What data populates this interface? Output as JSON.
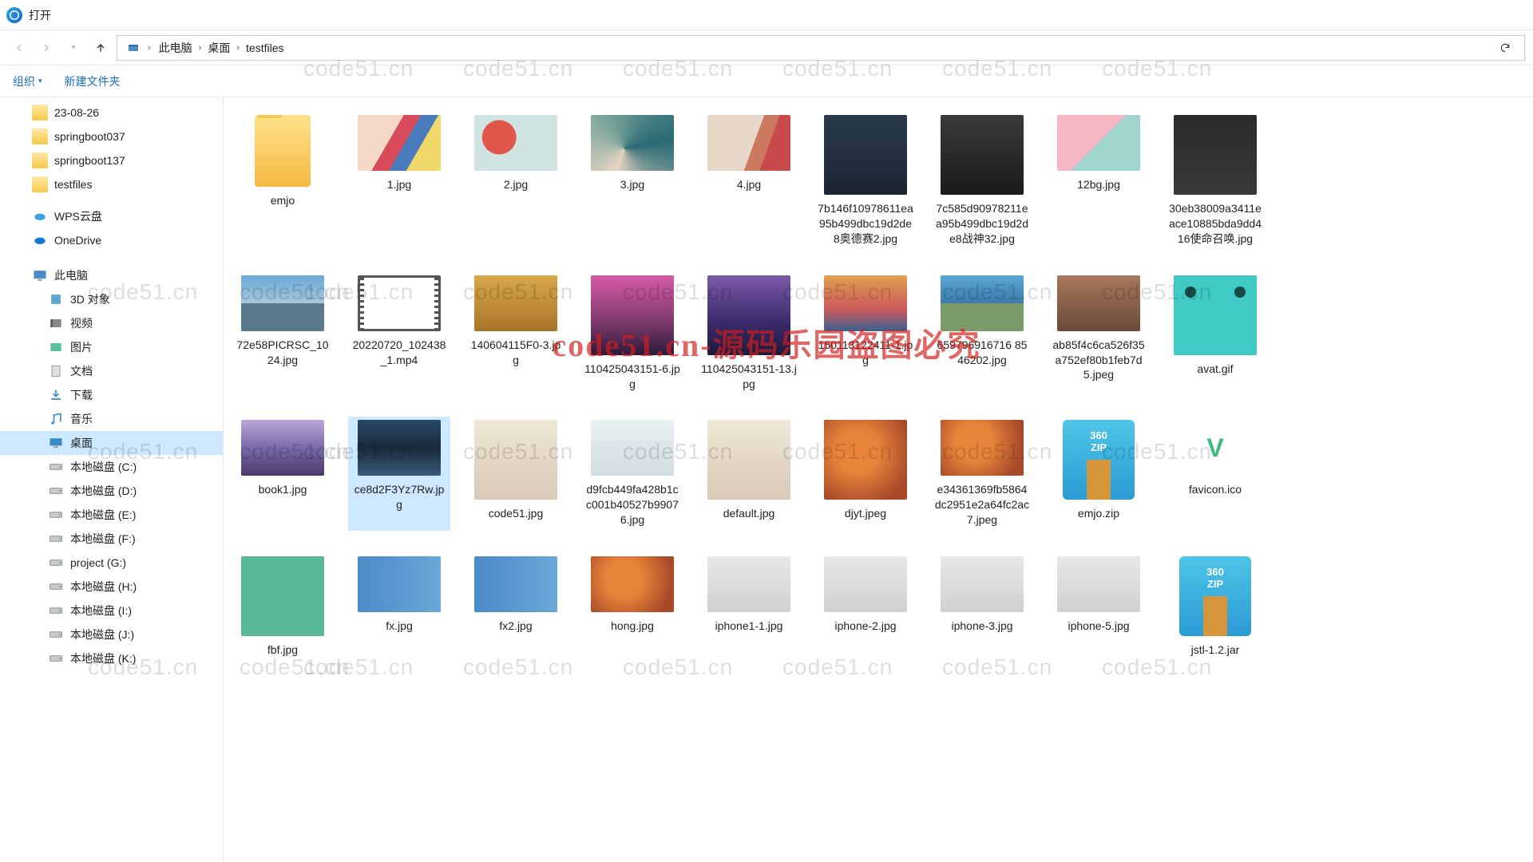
{
  "window": {
    "title": "打开"
  },
  "breadcrumbs": [
    "此电脑",
    "桌面",
    "testfiles"
  ],
  "toolbar": {
    "organize": "组织",
    "new_folder": "新建文件夹"
  },
  "sidebar": {
    "recent_folders": [
      "23-08-26",
      "springboot037",
      "springboot137",
      "testfiles"
    ],
    "clouds": [
      {
        "label": "WPS云盘",
        "icon": "wps"
      },
      {
        "label": "OneDrive",
        "icon": "onedrive"
      }
    ],
    "this_pc": "此电脑",
    "user_folders": [
      {
        "label": "3D 对象",
        "icon": "3d"
      },
      {
        "label": "视频",
        "icon": "video"
      },
      {
        "label": "图片",
        "icon": "pictures"
      },
      {
        "label": "文档",
        "icon": "docs"
      },
      {
        "label": "下载",
        "icon": "downloads"
      },
      {
        "label": "音乐",
        "icon": "music"
      },
      {
        "label": "桌面",
        "icon": "desktop",
        "selected": true
      }
    ],
    "drives": [
      "本地磁盘 (C:)",
      "本地磁盘 (D:)",
      "本地磁盘 (E:)",
      "本地磁盘 (F:)",
      "project (G:)",
      "本地磁盘 (H:)",
      "本地磁盘 (I:)",
      "本地磁盘 (J:)",
      "本地磁盘 (K:)"
    ]
  },
  "files": [
    {
      "name": "emjo",
      "type": "folder"
    },
    {
      "name": "1.jpg",
      "thumb": "art1"
    },
    {
      "name": "2.jpg",
      "thumb": "art2"
    },
    {
      "name": "3.jpg",
      "thumb": "art3"
    },
    {
      "name": "4.jpg",
      "thumb": "art4"
    },
    {
      "name": "7b146f10978611ea95b499dbc19d2de8奥德赛2.jpg",
      "thumb": "art5",
      "tall": true
    },
    {
      "name": "7c585d90978211ea95b499dbc19d2de8战神32.jpg",
      "thumb": "art6",
      "tall": true
    },
    {
      "name": "12bg.jpg",
      "thumb": "art7"
    },
    {
      "name": "30eb38009a3411eace10885bda9dd416使命召唤.jpg",
      "thumb": "art8",
      "tall": true
    },
    {
      "name": "72e58PICRSC_1024.jpg",
      "thumb": "sky1"
    },
    {
      "name": "20220720_102438_1.mp4",
      "thumb": "vid"
    },
    {
      "name": "140604115F0-3.jpg",
      "thumb": "sky3"
    },
    {
      "name": "110425043151-6.jpg",
      "thumb": "sky2",
      "tall": true
    },
    {
      "name": "110425043151-13.jpg",
      "thumb": "sky5",
      "tall": true
    },
    {
      "name": "150113122411-1.jpg",
      "thumb": "sky4"
    },
    {
      "name": "659796916716 8546202.jpg",
      "thumb": "sky6"
    },
    {
      "name": "ab85f4c6ca526f35a752ef80b1feb7d5.jpeg",
      "thumb": "sky7"
    },
    {
      "name": "avat.gif",
      "thumb": "avat",
      "tall": true
    },
    {
      "name": "book1.jpg",
      "thumb": "mtn"
    },
    {
      "name": "ce8d2F3Yz7Rw.jpg",
      "thumb": "lake",
      "selected": true
    },
    {
      "name": "code51.jpg",
      "thumb": "anime",
      "tall": true
    },
    {
      "name": "d9fcb449fa428b1cc001b40527b99076.jpg",
      "thumb": "white"
    },
    {
      "name": "default.jpg",
      "thumb": "anime",
      "tall": true
    },
    {
      "name": "djyt.jpeg",
      "thumb": "food",
      "tall": true
    },
    {
      "name": "e34361369fb5864dc2951e2a64fc2ac7.jpeg",
      "thumb": "food"
    },
    {
      "name": "emjo.zip",
      "type": "zip",
      "tall": true
    },
    {
      "name": "favicon.ico",
      "thumb": "fav"
    },
    {
      "name": "fbf.jpg",
      "thumb": "ppe",
      "tall": true
    },
    {
      "name": "fx.jpg",
      "thumb": "banner"
    },
    {
      "name": "fx2.jpg",
      "thumb": "banner"
    },
    {
      "name": "hong.jpg",
      "thumb": "food"
    },
    {
      "name": "iphone1-1.jpg",
      "thumb": "phone"
    },
    {
      "name": "iphone-2.jpg",
      "thumb": "phone"
    },
    {
      "name": "iphone-3.jpg",
      "thumb": "phone"
    },
    {
      "name": "iphone-5.jpg",
      "thumb": "phone"
    },
    {
      "name": "jstl-1.2.jar",
      "type": "zip",
      "tall": true
    }
  ],
  "watermark": {
    "repeat": "code51.cn",
    "big": "code51.cn-源码乐园盗图必究"
  },
  "zip_label": "360\nZIP"
}
